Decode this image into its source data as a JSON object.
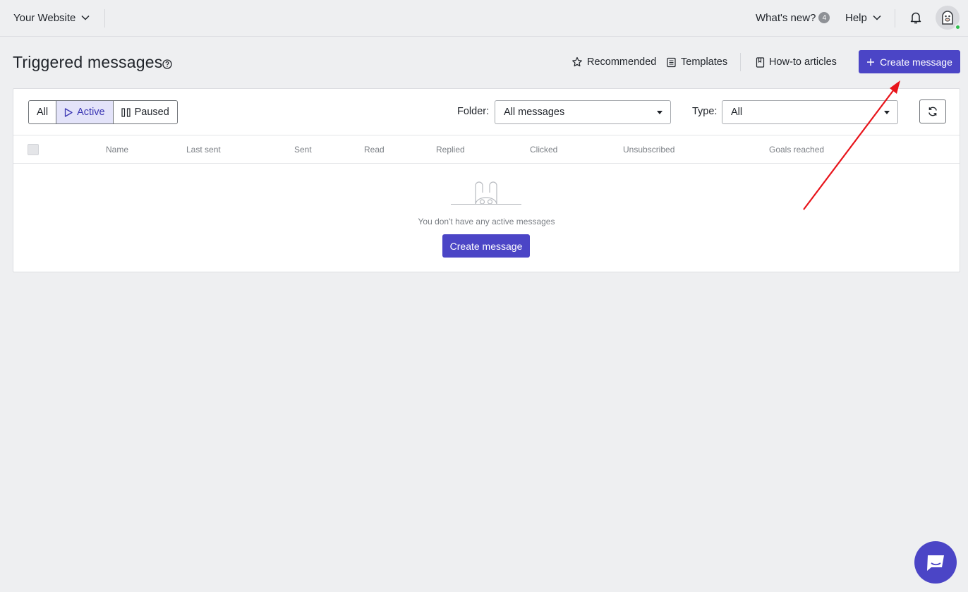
{
  "topbar": {
    "site_name": "Your Website",
    "whats_new": "What's new?",
    "whats_new_count": "4",
    "help": "Help"
  },
  "header": {
    "title": "Triggered messages",
    "recommended": "Recommended",
    "templates": "Templates",
    "howto": "How-to articles",
    "create": "Create message"
  },
  "filters": {
    "all": "All",
    "active": "Active",
    "paused": "Paused",
    "folder_label": "Folder:",
    "folder_value": "All messages",
    "type_label": "Type:",
    "type_value": "All"
  },
  "table": {
    "columns": [
      "Name",
      "Last sent",
      "Sent",
      "Read",
      "Replied",
      "Clicked",
      "Unsubscribed",
      "Goals reached"
    ]
  },
  "empty": {
    "text": "You don't have any active messages",
    "button": "Create message"
  },
  "colors": {
    "accent": "#4b45c6",
    "active_tab_bg": "#e3e3f9",
    "online": "#2fbf4e",
    "annotation_arrow": "#e8141b"
  }
}
